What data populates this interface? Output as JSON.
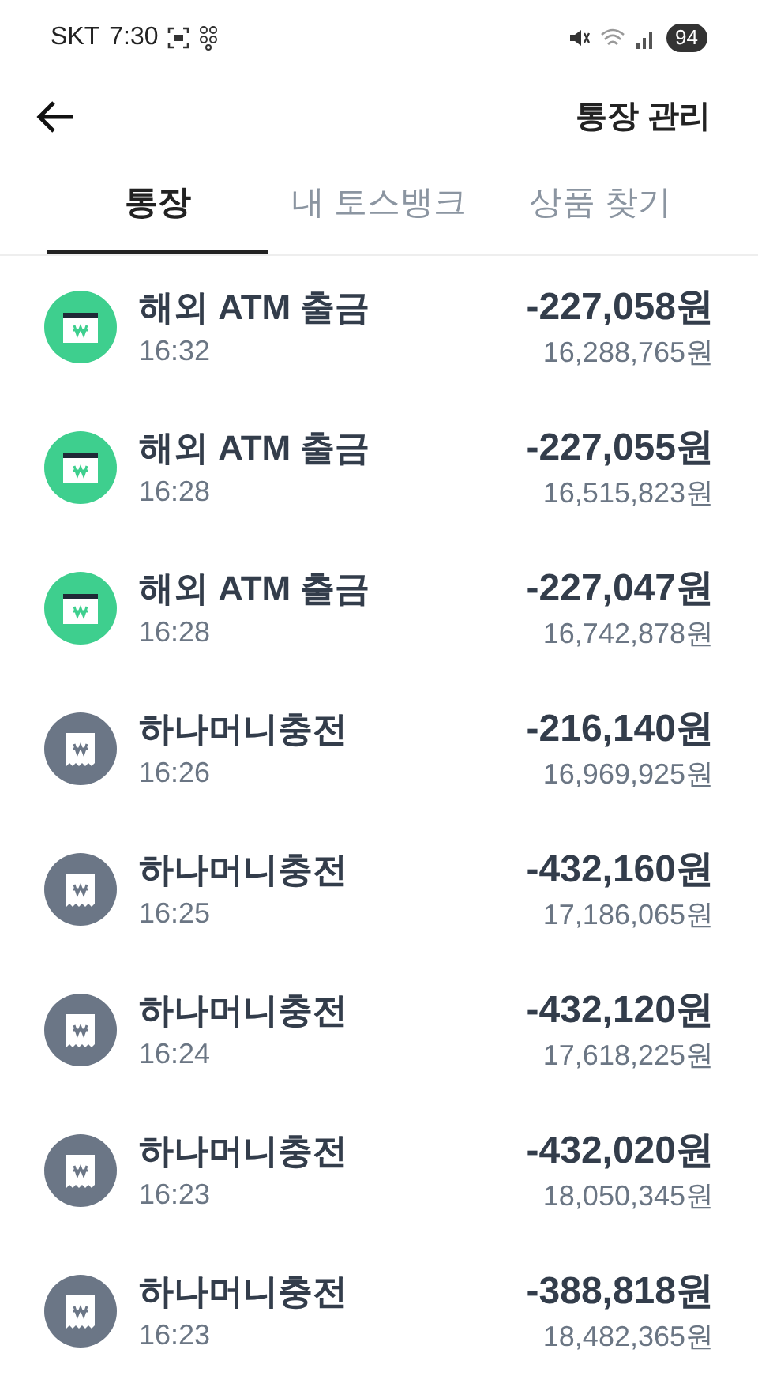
{
  "status_bar": {
    "carrier": "SKT",
    "time": "7:30",
    "battery": "94"
  },
  "header": {
    "title": "통장 관리"
  },
  "tabs": [
    {
      "label": "통장",
      "selected": true
    },
    {
      "label": "내 토스뱅크",
      "selected": false
    },
    {
      "label": "상품 찾기",
      "selected": false
    }
  ],
  "transactions": [
    {
      "kind": "atm",
      "title": "해외 ATM 출금",
      "time": "16:32",
      "amount": "-227,058원",
      "balance": "16,288,765원"
    },
    {
      "kind": "atm",
      "title": "해외 ATM 출금",
      "time": "16:28",
      "amount": "-227,055원",
      "balance": "16,515,823원"
    },
    {
      "kind": "atm",
      "title": "해외 ATM 출금",
      "time": "16:28",
      "amount": "-227,047원",
      "balance": "16,742,878원"
    },
    {
      "kind": "receipt",
      "title": "하나머니충전",
      "time": "16:26",
      "amount": "-216,140원",
      "balance": "16,969,925원"
    },
    {
      "kind": "receipt",
      "title": "하나머니충전",
      "time": "16:25",
      "amount": "-432,160원",
      "balance": "17,186,065원"
    },
    {
      "kind": "receipt",
      "title": "하나머니충전",
      "time": "16:24",
      "amount": "-432,120원",
      "balance": "17,618,225원"
    },
    {
      "kind": "receipt",
      "title": "하나머니충전",
      "time": "16:23",
      "amount": "-432,020원",
      "balance": "18,050,345원"
    },
    {
      "kind": "receipt",
      "title": "하나머니충전",
      "time": "16:23",
      "amount": "-388,818원",
      "balance": "18,482,365원"
    }
  ]
}
